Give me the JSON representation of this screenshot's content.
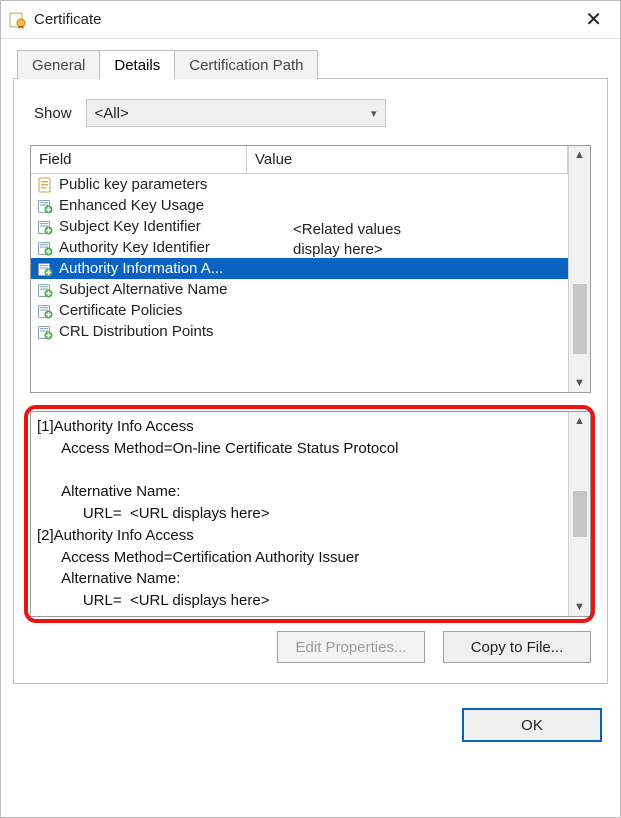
{
  "window": {
    "title": "Certificate"
  },
  "tabs": [
    {
      "label": "General",
      "active": false
    },
    {
      "label": "Details",
      "active": true
    },
    {
      "label": "Certification Path",
      "active": false
    }
  ],
  "show": {
    "label": "Show",
    "value": "<All>"
  },
  "columns": {
    "field": "Field",
    "value": "Value"
  },
  "value_placeholder": "<Related values\ndisplay here>",
  "fields": [
    {
      "label": "Public key parameters",
      "icon": "doc",
      "selected": false
    },
    {
      "label": "Enhanced Key Usage",
      "icon": "ext",
      "selected": false
    },
    {
      "label": "Subject Key Identifier",
      "icon": "ext",
      "selected": false
    },
    {
      "label": "Authority Key Identifier",
      "icon": "ext",
      "selected": false
    },
    {
      "label": "Authority Information A...",
      "icon": "ext",
      "selected": true
    },
    {
      "label": "Subject Alternative Name",
      "icon": "ext",
      "selected": false
    },
    {
      "label": "Certificate Policies",
      "icon": "ext",
      "selected": false
    },
    {
      "label": "CRL Distribution Points",
      "icon": "ext",
      "selected": false
    }
  ],
  "detail_text": "[1]Authority Info Access\n      Access Method=On-line Certificate Status Protocol\n\n      Alternative Name:\n           URL=  <URL displays here>\n[2]Authority Info Access\n      Access Method=Certification Authority Issuer\n      Alternative Name:\n           URL=  <URL displays here>",
  "buttons": {
    "edit": "Edit Properties...",
    "copy": "Copy to File...",
    "ok": "OK"
  }
}
